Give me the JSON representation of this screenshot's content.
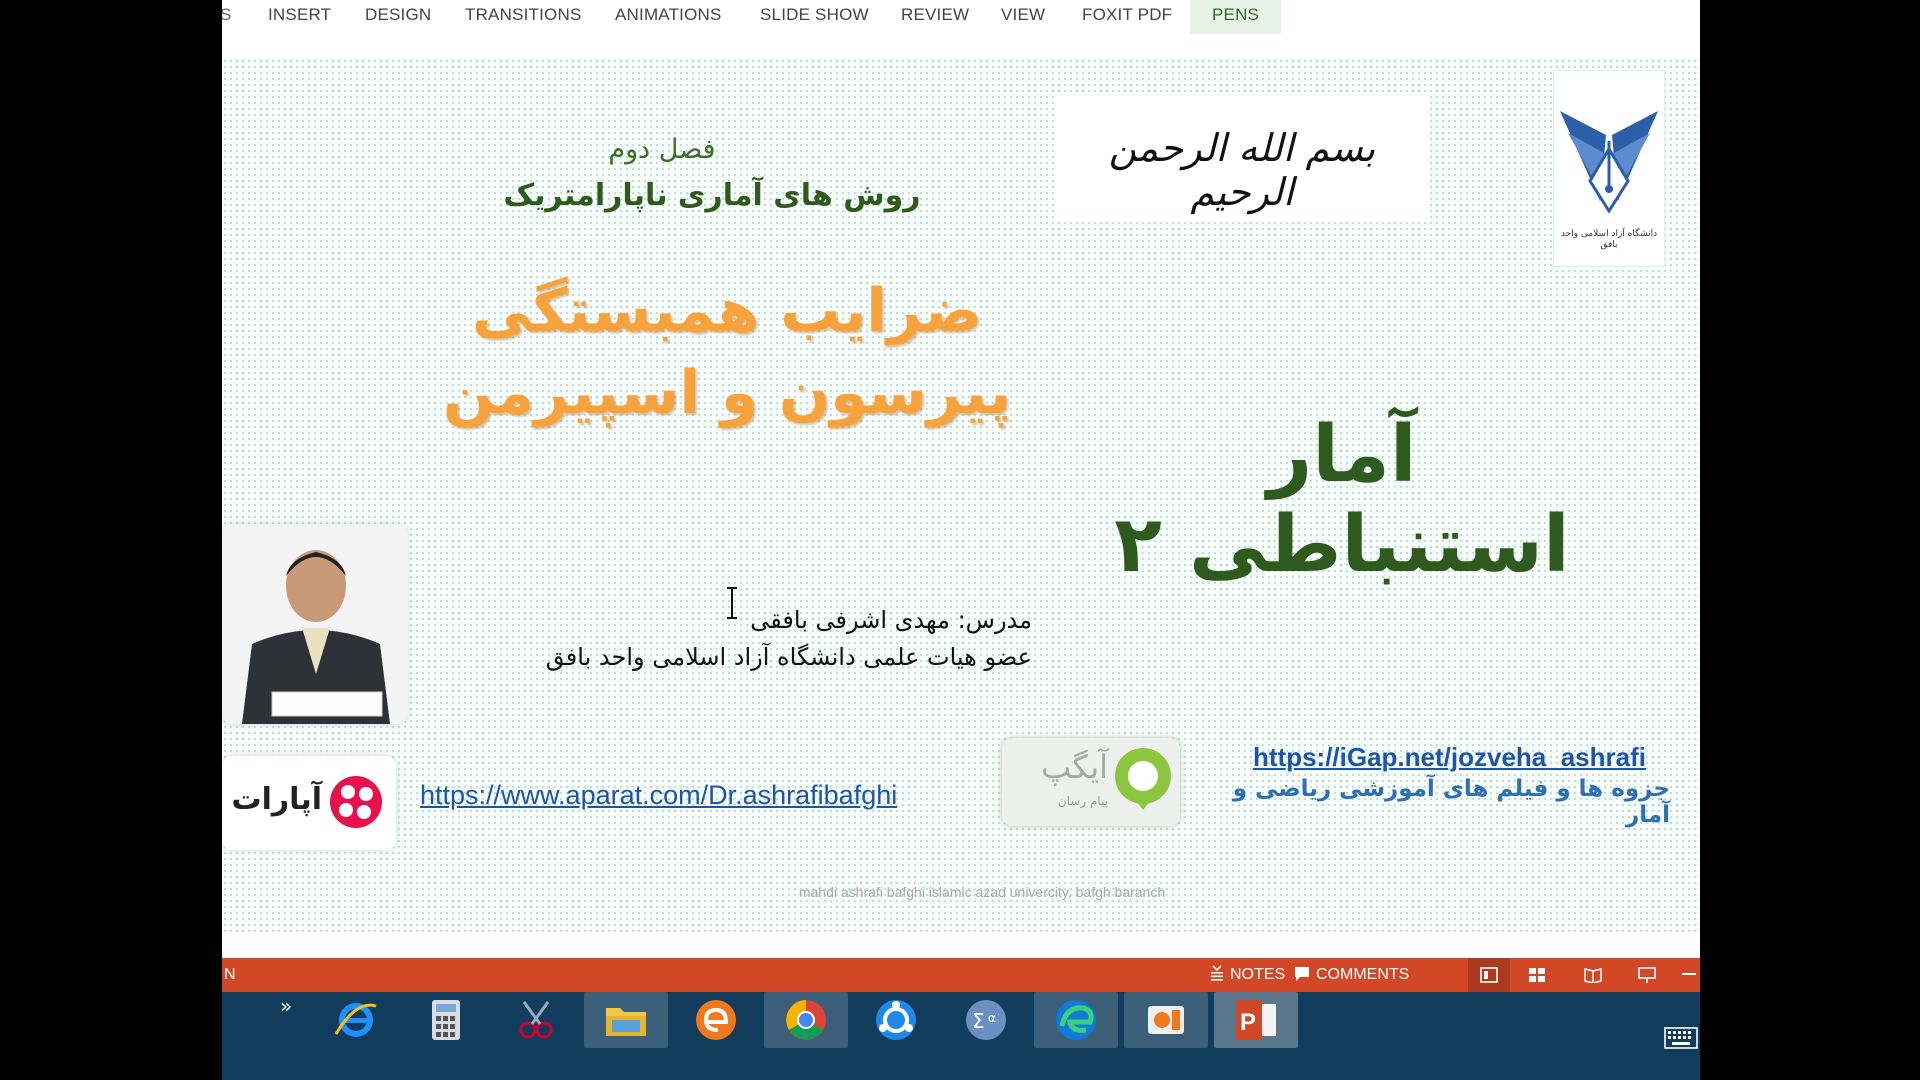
{
  "ribbon": {
    "tabs": [
      {
        "label": "INSERT"
      },
      {
        "label": "DESIGN"
      },
      {
        "label": "TRANSITIONS"
      },
      {
        "label": "ANIMATIONS"
      },
      {
        "label": "SLIDE SHOW"
      },
      {
        "label": "REVIEW"
      },
      {
        "label": "VIEW"
      },
      {
        "label": "FOXIT PDF"
      },
      {
        "label": "PENS"
      }
    ],
    "partial_tab": "S",
    "active_tab": "PENS"
  },
  "slide": {
    "basmala_text": "بسم الله الرحمن الرحیم",
    "university_logo_text": "دانشگاه آزاد اسلامی واحد بافق",
    "chapter": "فصل دوم",
    "chapter_subtitle": "روش های آماری ناپارامتریک",
    "main_title_line1": "ضرایب همبستگی",
    "main_title_line2": "پیرسون و اسپیرمن",
    "course_title": "آمار استنباطی ۲",
    "instructor_line1": "مدرس: مهدی اشرفی بافقی",
    "instructor_line2": "عضو هیات علمی دانشگاه آزاد اسلامی واحد بافق",
    "aparat_link": "https://www.aparat.com/Dr.ashrafibafghi",
    "aparat_logo_text": "آپارات",
    "igap_link": "https://iGap.net/jozveha_ashrafi",
    "igap_desc": "جزوه ها و فیلم های آموزشی ریاضی و آمار",
    "igap_logo_text": "آیگپ",
    "igap_logo_sub": "پیام رسان",
    "footer": "mahdi ashrafi bafghi  islamic azad univercity, bafgh baranch"
  },
  "statusbar": {
    "left_text": "N",
    "notes_label": "NOTES",
    "comments_label": "COMMENTS"
  },
  "colors": {
    "status_bar": "#d24726",
    "taskbar": "#123c5c",
    "title_orange": "#f7a23b",
    "title_green": "#2e5a1e",
    "link_blue": "#1f55a8"
  },
  "taskbar": {
    "chevron": "»",
    "apps": [
      {
        "icon": "internet-explorer-icon"
      },
      {
        "icon": "calculator-icon"
      },
      {
        "icon": "snipping-tool-icon"
      },
      {
        "icon": "file-explorer-icon"
      },
      {
        "icon": "eset-icon"
      },
      {
        "icon": "chrome-icon"
      },
      {
        "icon": "sync-icon"
      },
      {
        "icon": "math-input-icon"
      },
      {
        "icon": "edge-icon"
      },
      {
        "icon": "camera-app-icon"
      },
      {
        "icon": "powerpoint-icon"
      }
    ]
  }
}
